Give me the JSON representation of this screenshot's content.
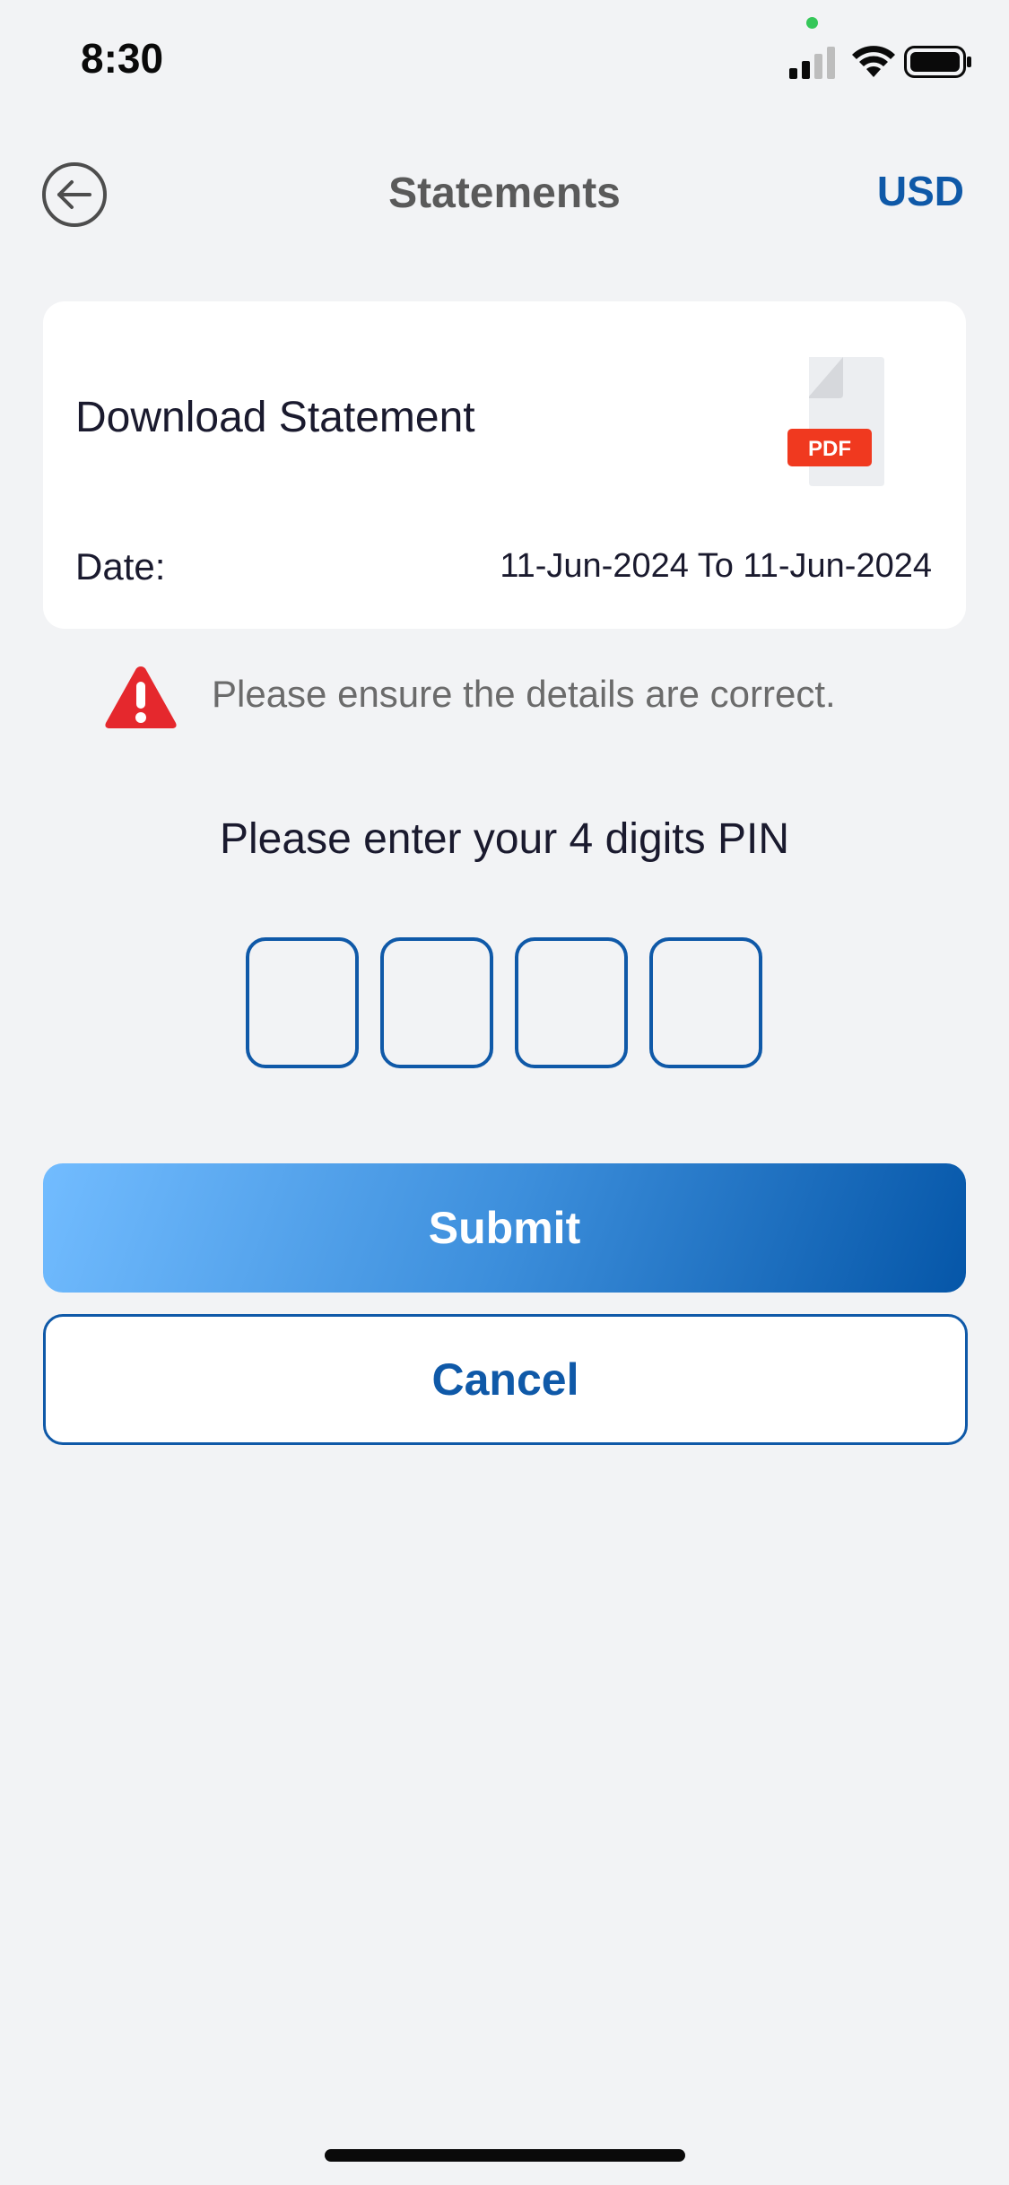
{
  "status_bar": {
    "time": "8:30"
  },
  "header": {
    "title": "Statements",
    "currency": "USD",
    "back_icon": "back-arrow-circle-icon"
  },
  "statement_card": {
    "title": "Download Statement",
    "pdf_badge": "PDF",
    "date_label": "Date:",
    "date_range": "11-Jun-2024 To 11-Jun-2024"
  },
  "warning": {
    "icon": "warning-triangle-icon",
    "text": "Please ensure the details are correct."
  },
  "pin": {
    "prompt": "Please enter your 4 digits PIN",
    "digits": [
      "",
      "",
      "",
      ""
    ]
  },
  "actions": {
    "submit_label": "Submit",
    "cancel_label": "Cancel"
  },
  "colors": {
    "brand_blue": "#0f59a8",
    "warning_red": "#e5282d",
    "pdf_red": "#f0391f",
    "background": "#f2f3f5"
  }
}
